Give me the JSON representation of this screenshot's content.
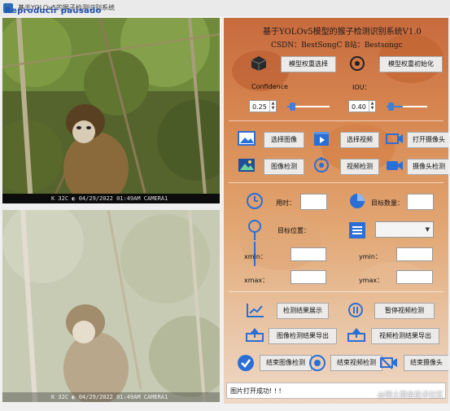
{
  "window": {
    "title": "基于YOLOv5的猴子检测识别系统",
    "overlay_watermark": "Reproducir pausado"
  },
  "video_top": {
    "caption": "K 32C  ◐  04/29/2022  01:49AM  CAMERA1"
  },
  "video_bottom": {
    "caption": "K 32C  ◐  04/29/2022  01:49AM  CAMERA1"
  },
  "panel": {
    "title": "基于YOLOv5模型的猴子检测识别系统V1.0",
    "subtitle": "CSDN：BestSongC   B站：Bestsongc",
    "model": {
      "select_weights": "模型权重选择",
      "init_weights": "模型权重初始化"
    },
    "confidence": {
      "label": "Confidence",
      "value": "0.25",
      "fraction": 0.25
    },
    "iou": {
      "label": "IOU：",
      "value": "0.40",
      "fraction": 0.4
    },
    "row1": {
      "select_image": "选择图像",
      "select_video": "选择视频",
      "open_camera": "打开摄像头"
    },
    "row2": {
      "image_detect": "图像检测",
      "video_detect": "视频检测",
      "camera_detect": "摄像头检测"
    },
    "stats": {
      "time_label": "用时：",
      "count_label": "目标数量：",
      "target_pos_label": "目标位置：",
      "xmin": "xmin：",
      "ymin": "ymin：",
      "xmax": "xmax：",
      "ymax": "ymax："
    },
    "results": {
      "show": "检测结果展示",
      "pause_video": "暂停视频检测",
      "export_image": "图像检测结果导出",
      "export_video": "视频检测结果导出",
      "end_image": "结束图像检测",
      "end_video": "结束视频检测",
      "end_camera": "结束摄像头"
    },
    "status_message": "图片打开成功! ! !"
  },
  "footer_watermark": "@稀土掘金技术社区",
  "colors": {
    "accent_blue": "#2a6fd6",
    "panel_orange": "#d98c55"
  }
}
